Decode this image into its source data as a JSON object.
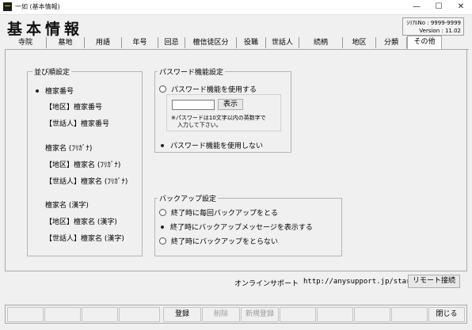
{
  "window": {
    "title": "一如 (基本情報)",
    "icon_glyph": "一",
    "minimize_glyph": "—",
    "maximize_glyph": "☐",
    "close_glyph": "✕"
  },
  "header": {
    "title": "基本情報",
    "serial_line": "ｼﾘｱﾙNo : 9999-9999",
    "version_line": "Version : 11.02"
  },
  "tabs": [
    {
      "label": "寺院"
    },
    {
      "label": "墓地"
    },
    {
      "label": "用語"
    },
    {
      "label": "年号"
    },
    {
      "label": "回忌"
    },
    {
      "label": "檀信徒区分"
    },
    {
      "label": "役職"
    },
    {
      "label": "世話人"
    },
    {
      "label": "続柄"
    },
    {
      "label": "地区"
    },
    {
      "label": "分類"
    },
    {
      "label": "その他"
    }
  ],
  "sort_settings": {
    "legend": "並び順設定",
    "options": [
      {
        "label": "檀家番号",
        "selected": true
      },
      {
        "label": "【地区】檀家番号",
        "selected": false
      },
      {
        "label": "【世話人】檀家番号",
        "selected": false
      },
      {
        "label": "檀家名 (ﾌﾘｶﾞﾅ)",
        "selected": false
      },
      {
        "label": "【地区】檀家名 (ﾌﾘｶﾞﾅ)",
        "selected": false
      },
      {
        "label": "【世話人】檀家名 (ﾌﾘｶﾞﾅ)",
        "selected": false
      },
      {
        "label": "檀家名 (漢字)",
        "selected": false
      },
      {
        "label": "【地区】檀家名 (漢字)",
        "selected": false
      },
      {
        "label": "【世話人】檀家名 (漢字)",
        "selected": false
      }
    ]
  },
  "password_settings": {
    "legend": "パスワード機能設定",
    "use_label": "パスワード機能を使用する",
    "use_selected": false,
    "password_value": "",
    "display_button": "表示",
    "note_line1": "※パスワードは10文字以内の英数字で",
    "note_line2": "入力して下さい。",
    "nouse_label": "パスワード機能を使用しない",
    "nouse_selected": true
  },
  "backup_settings": {
    "legend": "バックアップ設定",
    "options": [
      {
        "label": "終了時に毎回バックアップをとる",
        "selected": false
      },
      {
        "label": "終了時にバックアップメッセージを表示する",
        "selected": true
      },
      {
        "label": "終了時にバックアップをとらない",
        "selected": false
      }
    ]
  },
  "support": {
    "label": "オンラインサポート",
    "url": "http://anysupport.jp/stars/",
    "remote_button": "リモート接続"
  },
  "bottom_bar": {
    "register": "登録",
    "delete": "削除",
    "new_register": "新規登録",
    "close": "閉じる"
  }
}
